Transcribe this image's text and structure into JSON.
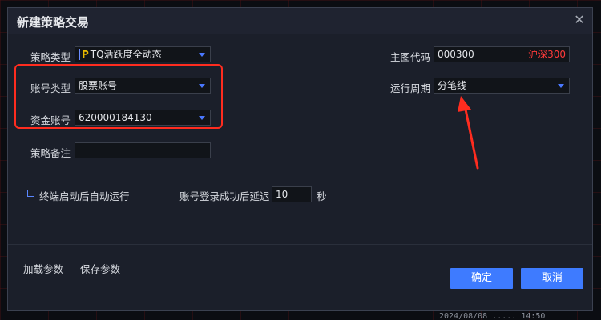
{
  "background": {
    "footer_text": "2024/08/08 ..... 14:50"
  },
  "dialog": {
    "title": "新建策略交易",
    "close_icon": "close-icon"
  },
  "form": {
    "strategy_type": {
      "label": "策略类型",
      "value": "TQ活跃度全动态",
      "logo": "P"
    },
    "account_type": {
      "label": "账号类型",
      "value": "股票账号"
    },
    "fund_account": {
      "label": "资金账号",
      "value": "620000184130"
    },
    "strategy_note": {
      "label": "策略备注",
      "value": ""
    },
    "main_code": {
      "label": "主图代码",
      "value": "000300",
      "suffix": "沪深300"
    },
    "period": {
      "label": "运行周期",
      "value": "分笔线"
    },
    "auto_run": {
      "label": "终端启动后自动运行",
      "checked": false
    },
    "delay": {
      "label": "账号登录成功后延迟",
      "value": "10",
      "unit": "秒"
    }
  },
  "footer": {
    "load_params": "加载参数",
    "save_params": "保存参数",
    "confirm": "确定",
    "cancel": "取消"
  },
  "colors": {
    "accent": "#3e7bff",
    "highlight": "#ff2c1f",
    "suffix": "#ff3a3a"
  }
}
